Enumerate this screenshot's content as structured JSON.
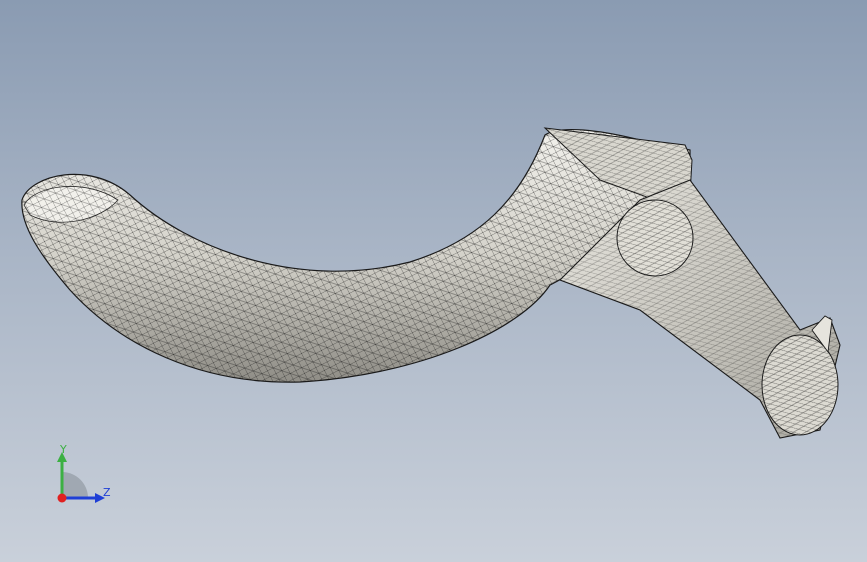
{
  "viewport": {
    "background_top": "#8a9bb2",
    "background_bottom": "#c9d0da"
  },
  "model": {
    "surface_color": "#cfcdc5",
    "edge_color": "#1a1a1a",
    "display_mode": "shaded-with-mesh-edges"
  },
  "triad": {
    "y_label": "Y",
    "z_label": "Z",
    "y_color": "#3cb043",
    "z_color": "#1f3fd6",
    "x_color": "#e02020"
  }
}
